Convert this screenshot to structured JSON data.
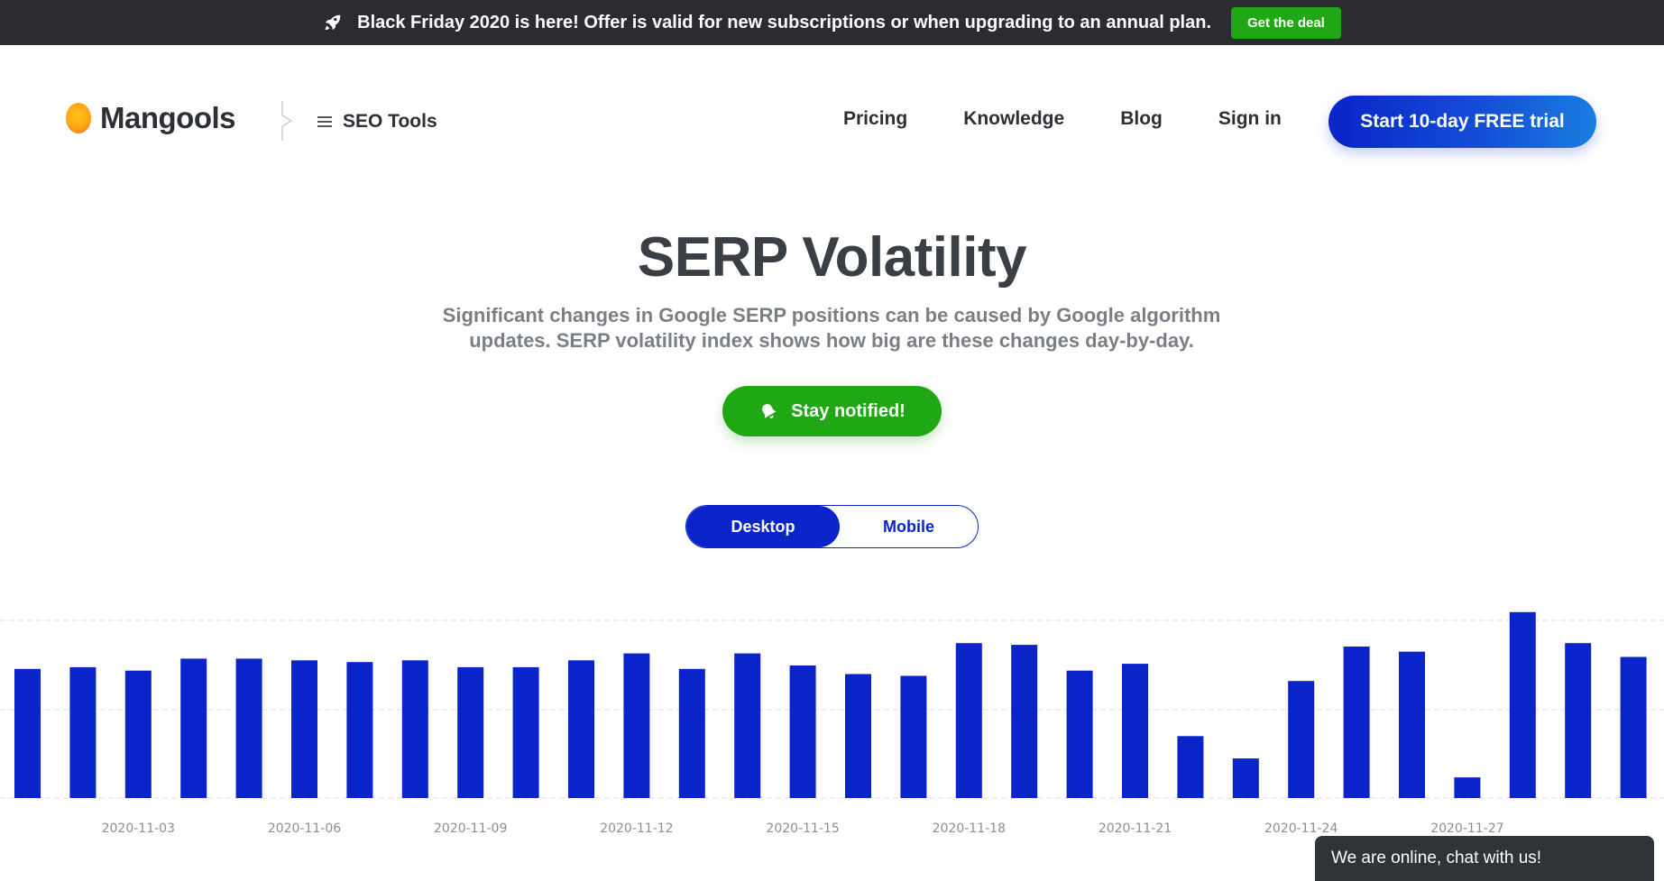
{
  "promo": {
    "message": "Black Friday 2020 is here! Offer is valid for new subscriptions or when upgrading to an annual plan.",
    "cta": "Get the deal",
    "icon": "rocket-icon"
  },
  "header": {
    "logo_text": "Mangools",
    "seo_tools": "SEO Tools",
    "nav": [
      "Pricing",
      "Knowledge",
      "Blog",
      "Sign in"
    ],
    "cta": "Start 10-day FREE trial"
  },
  "hero": {
    "title": "SERP Volatility",
    "subtitle_line1": "Significant changes in Google SERP positions can be caused by Google algorithm",
    "subtitle_line2": "updates. SERP volatility index shows how big are these changes day-by-day.",
    "notify": "Stay notified!"
  },
  "toggle": {
    "options": [
      "Desktop",
      "Mobile"
    ],
    "selected": "Desktop"
  },
  "chat": {
    "label": "We are online, chat with us!"
  },
  "colors": {
    "accent_blue": "#0a24c9",
    "accent_green": "#1fa814",
    "promo_bg": "#2a2c31"
  },
  "chart_data": {
    "type": "bar",
    "x": [
      "2020-11-01",
      "2020-11-02",
      "2020-11-03",
      "2020-11-04",
      "2020-11-05",
      "2020-11-06",
      "2020-11-07",
      "2020-11-08",
      "2020-11-09",
      "2020-11-10",
      "2020-11-11",
      "2020-11-12",
      "2020-11-13",
      "2020-11-14",
      "2020-11-15",
      "2020-11-16",
      "2020-11-17",
      "2020-11-18",
      "2020-11-19",
      "2020-11-20",
      "2020-11-21",
      "2020-11-22",
      "2020-11-23",
      "2020-11-24",
      "2020-11-25",
      "2020-11-26",
      "2020-11-27",
      "2020-11-28",
      "2020-11-29",
      "2020-11-30"
    ],
    "tick_labels": [
      "2020-11-03",
      "2020-11-06",
      "2020-11-09",
      "2020-11-12",
      "2020-11-15",
      "2020-11-18",
      "2020-11-21",
      "2020-11-24",
      "2020-11-27"
    ],
    "values": [
      7.5,
      7.6,
      7.4,
      8.1,
      8.1,
      8.0,
      7.9,
      8.0,
      7.6,
      7.6,
      8.0,
      8.4,
      7.5,
      8.4,
      7.7,
      7.2,
      7.1,
      9.0,
      8.9,
      7.4,
      7.8,
      3.6,
      2.3,
      6.8,
      8.8,
      8.5,
      1.2,
      10.8,
      9.0,
      8.2
    ],
    "ylim": [
      0,
      11
    ],
    "grid": true,
    "color": "#0a24c9"
  }
}
